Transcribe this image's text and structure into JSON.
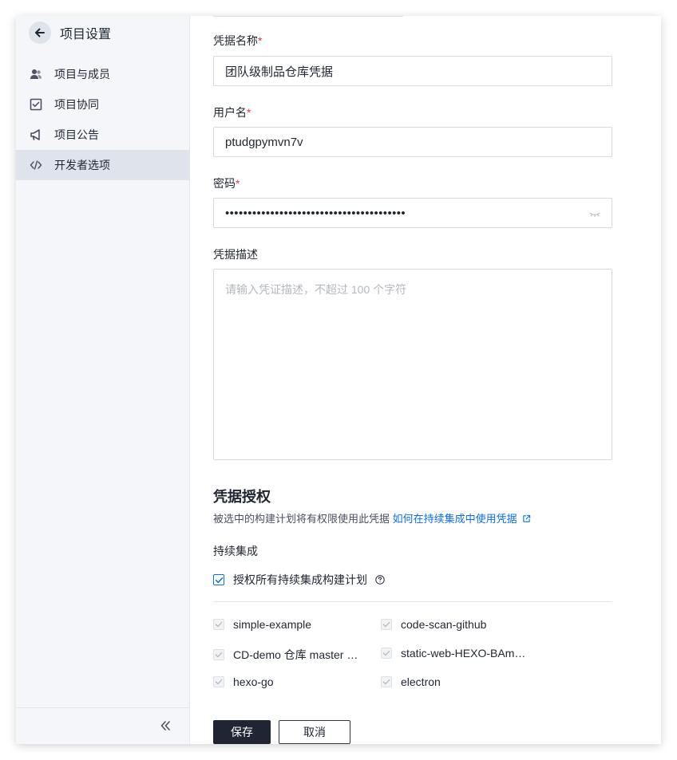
{
  "sidebar": {
    "title": "项目设置",
    "items": [
      {
        "label": "项目与成员",
        "icon": "members-icon"
      },
      {
        "label": "项目协同",
        "icon": "collab-icon"
      },
      {
        "label": "项目公告",
        "icon": "announcement-icon"
      },
      {
        "label": "开发者选项",
        "icon": "code-icon",
        "active": true
      }
    ]
  },
  "form": {
    "name": {
      "label": "凭据名称",
      "required_mark": "*",
      "value": "团队级制品仓库凭据"
    },
    "username": {
      "label": "用户名",
      "required_mark": "*",
      "value": "ptudgpymvn7v"
    },
    "password": {
      "label": "密码",
      "required_mark": "*",
      "value": "••••••••••••••••••••••••••••••••••••••••"
    },
    "description": {
      "label": "凭据描述",
      "placeholder": "请输入凭证描述，不超过 100 个字符"
    }
  },
  "auth": {
    "title": "凭据授权",
    "desc": "被选中的构建计划将有权限使用此凭据",
    "link": "如何在持续集成中使用凭据",
    "ci_title": "持续集成",
    "authorize_all": "授权所有持续集成构建计划",
    "authorize_all_checked": true,
    "plans": [
      "simple-example",
      "code-scan-github",
      "CD-demo 仓库 master …",
      "static-web-HEXO-BAm…",
      "hexo-go",
      "electron"
    ]
  },
  "buttons": {
    "save": "保存",
    "cancel": "取消"
  },
  "colors": {
    "accent": "#0b6ef2",
    "required": "#e5343a",
    "primary_button": "#1f2533"
  }
}
